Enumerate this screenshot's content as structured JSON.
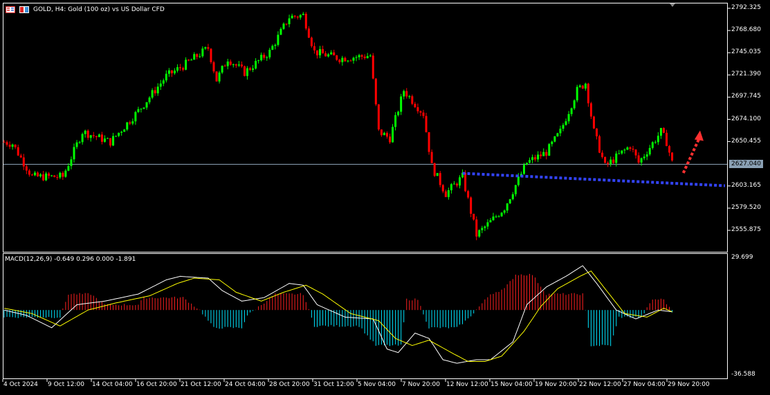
{
  "header": {
    "symbol_title": "GOLD, H4:  Gold (100 oz) vs US Dollar CFD",
    "icons": [
      "window-list-icon",
      "one-click-trading-icon"
    ]
  },
  "indicator": {
    "label": "MACD(12,26,9) -0.649 0.296 0.000 -1.891"
  },
  "colors": {
    "bull": "#00ff00",
    "bear": "#ff0000",
    "hist_pos": "#ff2020",
    "hist_neg": "#00e5ff",
    "macd_line": "#ffffff",
    "signal_line": "#ffff00",
    "trendline": "#3344ff",
    "arrow": "#ff3030",
    "grid_border": "#ffffff",
    "price_line": "#8aa0b4"
  },
  "chart_data": {
    "type": "candlestick",
    "price_axis": {
      "ticks": [
        "2792.325",
        "2768.680",
        "2745.035",
        "2721.390",
        "2697.745",
        "2674.100",
        "2650.455",
        "2627.040",
        "2603.165",
        "2579.520",
        "2555.875"
      ],
      "range": [
        2547,
        2797
      ]
    },
    "current_price": "2627.040",
    "bars": 240,
    "close_keypoints": [
      [
        0,
        2650
      ],
      [
        3,
        2648
      ],
      [
        10,
        2613
      ],
      [
        21,
        2613
      ],
      [
        28,
        2661
      ],
      [
        38,
        2650
      ],
      [
        48,
        2683
      ],
      [
        58,
        2720
      ],
      [
        64,
        2731
      ],
      [
        73,
        2750
      ],
      [
        76,
        2716
      ],
      [
        80,
        2739
      ],
      [
        86,
        2724
      ],
      [
        95,
        2746
      ],
      [
        102,
        2783
      ],
      [
        107,
        2785
      ],
      [
        111,
        2746
      ],
      [
        120,
        2739
      ],
      [
        131,
        2742
      ],
      [
        134,
        2661
      ],
      [
        138,
        2654
      ],
      [
        143,
        2705
      ],
      [
        150,
        2680
      ],
      [
        153,
        2624
      ],
      [
        158,
        2595
      ],
      [
        164,
        2613
      ],
      [
        169,
        2551
      ],
      [
        174,
        2565
      ],
      [
        179,
        2580
      ],
      [
        187,
        2628
      ],
      [
        194,
        2639
      ],
      [
        199,
        2661
      ],
      [
        205,
        2705
      ],
      [
        208,
        2713
      ],
      [
        211,
        2661
      ],
      [
        215,
        2624
      ],
      [
        224,
        2646
      ],
      [
        227,
        2628
      ],
      [
        235,
        2661
      ],
      [
        237,
        2650
      ],
      [
        239,
        2628
      ]
    ],
    "macd_axis": {
      "ticks": [
        "29.699",
        "-36.588"
      ],
      "range": [
        -36.588,
        29.699
      ]
    },
    "histogram_keypoints": [
      [
        0,
        -4
      ],
      [
        20,
        -4
      ],
      [
        23,
        9
      ],
      [
        31,
        9
      ],
      [
        36,
        3
      ],
      [
        48,
        3
      ],
      [
        50,
        7
      ],
      [
        64,
        7
      ],
      [
        70,
        0
      ],
      [
        75,
        -10
      ],
      [
        85,
        -10
      ],
      [
        87,
        -3
      ],
      [
        97,
        9
      ],
      [
        107,
        9
      ],
      [
        111,
        -9
      ],
      [
        127,
        -9
      ],
      [
        133,
        -20
      ],
      [
        142,
        -20
      ],
      [
        144,
        6
      ],
      [
        148,
        6
      ],
      [
        152,
        -10
      ],
      [
        162,
        -10
      ],
      [
        166,
        -5
      ],
      [
        174,
        9
      ],
      [
        179,
        12
      ],
      [
        183,
        20
      ],
      [
        189,
        20
      ],
      [
        194,
        9
      ],
      [
        207,
        9
      ],
      [
        210,
        -20
      ],
      [
        217,
        -20
      ],
      [
        220,
        -4
      ],
      [
        228,
        -4
      ],
      [
        232,
        6
      ],
      [
        236,
        6
      ],
      [
        239,
        -1
      ]
    ],
    "macd_keypoints": [
      [
        0,
        0
      ],
      [
        8,
        -3
      ],
      [
        17,
        -10
      ],
      [
        26,
        3
      ],
      [
        36,
        5
      ],
      [
        48,
        9
      ],
      [
        58,
        17
      ],
      [
        63,
        19
      ],
      [
        73,
        18
      ],
      [
        78,
        11
      ],
      [
        85,
        5
      ],
      [
        93,
        7
      ],
      [
        102,
        15
      ],
      [
        107,
        14
      ],
      [
        112,
        3
      ],
      [
        122,
        -4
      ],
      [
        132,
        -5
      ],
      [
        137,
        -22
      ],
      [
        141,
        -24
      ],
      [
        147,
        -13
      ],
      [
        152,
        -16
      ],
      [
        157,
        -28
      ],
      [
        162,
        -30
      ],
      [
        169,
        -28
      ],
      [
        174,
        -28
      ],
      [
        182,
        -18
      ],
      [
        187,
        3
      ],
      [
        194,
        13
      ],
      [
        201,
        19
      ],
      [
        207,
        25
      ],
      [
        212,
        15
      ],
      [
        219,
        0
      ],
      [
        226,
        -5
      ],
      [
        234,
        0
      ],
      [
        239,
        -1
      ]
    ],
    "signal_keypoints": [
      [
        0,
        1
      ],
      [
        10,
        -2
      ],
      [
        20,
        -9
      ],
      [
        30,
        0
      ],
      [
        40,
        4
      ],
      [
        52,
        8
      ],
      [
        62,
        15
      ],
      [
        68,
        18
      ],
      [
        77,
        17
      ],
      [
        83,
        10
      ],
      [
        92,
        5
      ],
      [
        100,
        10
      ],
      [
        108,
        14
      ],
      [
        114,
        9
      ],
      [
        124,
        -2
      ],
      [
        134,
        -6
      ],
      [
        140,
        -16
      ],
      [
        146,
        -20
      ],
      [
        152,
        -17
      ],
      [
        160,
        -24
      ],
      [
        166,
        -29
      ],
      [
        172,
        -29
      ],
      [
        178,
        -26
      ],
      [
        186,
        -12
      ],
      [
        192,
        2
      ],
      [
        198,
        12
      ],
      [
        206,
        19
      ],
      [
        210,
        22
      ],
      [
        216,
        10
      ],
      [
        222,
        -2
      ],
      [
        230,
        -4
      ],
      [
        236,
        1
      ],
      [
        239,
        -1
      ]
    ],
    "time_labels": [
      "4 Oct 2024",
      "9 Oct 12:00",
      "14 Oct 04:00",
      "16 Oct 20:00",
      "21 Oct 12:00",
      "24 Oct 04:00",
      "28 Oct 20:00",
      "31 Oct 12:00",
      "5 Nov 04:00",
      "7 Nov 20:00",
      "12 Nov 12:00",
      "15 Nov 04:00",
      "19 Nov 20:00",
      "22 Nov 12:00",
      "27 Nov 04:00",
      "29 Nov 20:00"
    ],
    "trendline": {
      "from": [
        164,
        2616.6
      ],
      "to": [
        257,
        2603.4
      ]
    },
    "arrow": {
      "from": [
        243,
        2617
      ],
      "to": [
        248,
        2660
      ]
    }
  }
}
